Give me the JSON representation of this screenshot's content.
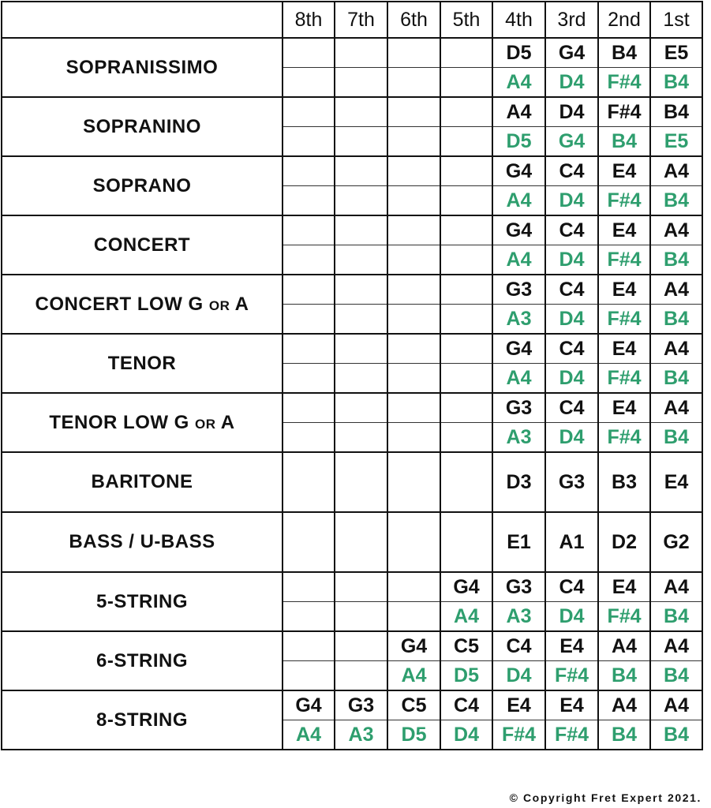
{
  "columns": [
    "8th",
    "7th",
    "6th",
    "5th",
    "4th",
    "3rd",
    "2nd",
    "1st"
  ],
  "colors": {
    "standard": "#111111",
    "alternate": "#2e9e6e"
  },
  "instruments": [
    {
      "name": "SOPRANISSIMO",
      "suffix": "",
      "tail": "",
      "standard": [
        "",
        "",
        "",
        "",
        "D5",
        "G4",
        "B4",
        "E5"
      ],
      "alternate": [
        "",
        "",
        "",
        "",
        "A4",
        "D4",
        "F#4",
        "B4"
      ]
    },
    {
      "name": "SOPRANINO",
      "suffix": "",
      "tail": "",
      "standard": [
        "",
        "",
        "",
        "",
        "A4",
        "D4",
        "F#4",
        "B4"
      ],
      "alternate": [
        "",
        "",
        "",
        "",
        "D5",
        "G4",
        "B4",
        "E5"
      ]
    },
    {
      "name": "SOPRANO",
      "suffix": "",
      "tail": "",
      "standard": [
        "",
        "",
        "",
        "",
        "G4",
        "C4",
        "E4",
        "A4"
      ],
      "alternate": [
        "",
        "",
        "",
        "",
        "A4",
        "D4",
        "F#4",
        "B4"
      ]
    },
    {
      "name": "CONCERT",
      "suffix": "",
      "tail": "",
      "standard": [
        "",
        "",
        "",
        "",
        "G4",
        "C4",
        "E4",
        "A4"
      ],
      "alternate": [
        "",
        "",
        "",
        "",
        "A4",
        "D4",
        "F#4",
        "B4"
      ]
    },
    {
      "name": "CONCERT LOW G ",
      "suffix": "OR",
      "tail": " A",
      "standard": [
        "",
        "",
        "",
        "",
        "G3",
        "C4",
        "E4",
        "A4"
      ],
      "alternate": [
        "",
        "",
        "",
        "",
        "A3",
        "D4",
        "F#4",
        "B4"
      ]
    },
    {
      "name": "TENOR",
      "suffix": "",
      "tail": "",
      "standard": [
        "",
        "",
        "",
        "",
        "G4",
        "C4",
        "E4",
        "A4"
      ],
      "alternate": [
        "",
        "",
        "",
        "",
        "A4",
        "D4",
        "F#4",
        "B4"
      ]
    },
    {
      "name": "TENOR LOW G ",
      "suffix": "OR",
      "tail": " A",
      "standard": [
        "",
        "",
        "",
        "",
        "G3",
        "C4",
        "E4",
        "A4"
      ],
      "alternate": [
        "",
        "",
        "",
        "",
        "A3",
        "D4",
        "F#4",
        "B4"
      ]
    },
    {
      "name": "BARITONE",
      "suffix": "",
      "tail": "",
      "standard": [
        "",
        "",
        "",
        "",
        "D3",
        "G3",
        "B3",
        "E4"
      ],
      "alternate": null
    },
    {
      "name": "BASS / U-BASS",
      "suffix": "",
      "tail": "",
      "standard": [
        "",
        "",
        "",
        "",
        "E1",
        "A1",
        "D2",
        "G2"
      ],
      "alternate": null
    },
    {
      "name": "5-STRING",
      "suffix": "",
      "tail": "",
      "standard": [
        "",
        "",
        "",
        "G4",
        "G3",
        "C4",
        "E4",
        "A4"
      ],
      "alternate": [
        "",
        "",
        "",
        "A4",
        "A3",
        "D4",
        "F#4",
        "B4"
      ]
    },
    {
      "name": "6-STRING",
      "suffix": "",
      "tail": "",
      "standard": [
        "",
        "",
        "G4",
        "C5",
        "C4",
        "E4",
        "A4",
        "A4"
      ],
      "alternate": [
        "",
        "",
        "A4",
        "D5",
        "D4",
        "F#4",
        "B4",
        "B4"
      ]
    },
    {
      "name": "8-STRING",
      "suffix": "",
      "tail": "",
      "standard": [
        "G4",
        "G3",
        "C5",
        "C4",
        "E4",
        "E4",
        "A4",
        "A4"
      ],
      "alternate": [
        "A4",
        "A3",
        "D5",
        "D4",
        "F#4",
        "F#4",
        "B4",
        "B4"
      ]
    }
  ],
  "footer": {
    "copyright": "© Copyright Fret Expert 2021."
  }
}
